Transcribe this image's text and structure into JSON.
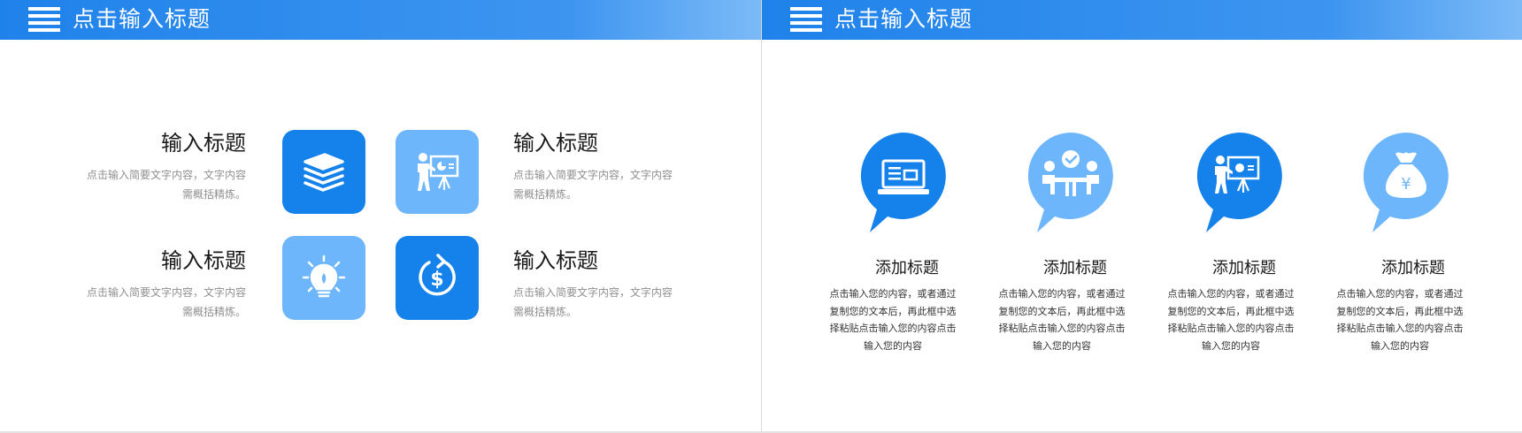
{
  "left_slide": {
    "header_title": "点击输入标题",
    "items": [
      {
        "title": "输入标题",
        "desc": "点击输入简要文字内容，文字内容需概括精炼。",
        "icon": "stack-icon"
      },
      {
        "title": "输入标题",
        "desc": "点击输入简要文字内容，文字内容需概括精炼。",
        "icon": "presenter-icon"
      },
      {
        "title": "输入标题",
        "desc": "点击输入简要文字内容，文字内容需概括精炼。",
        "icon": "lightbulb-icon"
      },
      {
        "title": "输入标题",
        "desc": "点击输入简要文字内容，文字内容需概括精炼。",
        "icon": "dollar-cycle-icon"
      }
    ]
  },
  "right_slide": {
    "header_title": "点击输入标题",
    "columns": [
      {
        "title": "添加标题",
        "desc": "点击输入您的内容，或者通过复制您的文本后，再此框中选择粘贴点击输入您的内容点击输入您的内容",
        "icon": "laptop-icon"
      },
      {
        "title": "添加标题",
        "desc": "点击输入您的内容，或者通过复制您的文本后，再此框中选择粘贴点击输入您的内容点击输入您的内容",
        "icon": "meeting-icon"
      },
      {
        "title": "添加标题",
        "desc": "点击输入您的内容，或者通过复制您的文本后，再此框中选择粘贴点击输入您的内容点击输入您的内容",
        "icon": "presenter-icon"
      },
      {
        "title": "添加标题",
        "desc": "点击输入您的内容，或者通过复制您的文本后，再此框中选择粘贴点击输入您的内容点击输入您的内容",
        "icon": "money-bag-icon"
      }
    ],
    "yen_symbol": "¥"
  },
  "colors": {
    "primary": "#1482ea",
    "light": "#6db6fb",
    "header_gradient_end": "#7cbaf7"
  }
}
